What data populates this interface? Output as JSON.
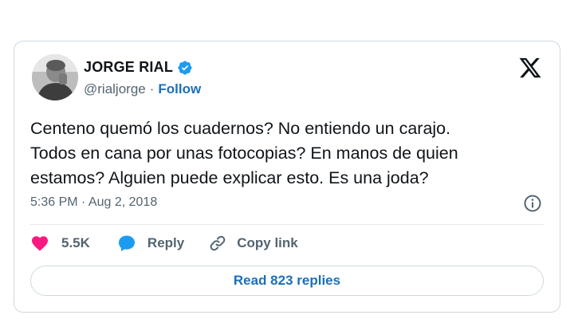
{
  "author": {
    "name": "JORGE RIAL",
    "handle": "@rialjorge",
    "separator": "·",
    "follow_label": "Follow"
  },
  "tweet": {
    "lines": [
      "Centeno quemó los cuadernos? No entiendo un carajo.",
      "Todos en cana por unas fotocopias? En manos de quien",
      "estamos? Alguien puede explicar esto. Es una joda?"
    ],
    "timestamp": "5:36 PM · Aug 2, 2018"
  },
  "actions": {
    "like_count": "5.5K",
    "reply_label": "Reply",
    "copy_label": "Copy link"
  },
  "read_replies_label": "Read 823 replies",
  "icons": {
    "verified": "verified-badge-icon",
    "x_logo": "x-logo-icon",
    "info": "info-icon",
    "heart": "heart-icon",
    "reply": "speech-bubble-icon",
    "copy": "link-icon"
  },
  "colors": {
    "accent": "#1d6fb8",
    "verified": "#1d9bf0",
    "heart": "#f91880",
    "muted": "#536471",
    "border": "#cfd9de"
  }
}
